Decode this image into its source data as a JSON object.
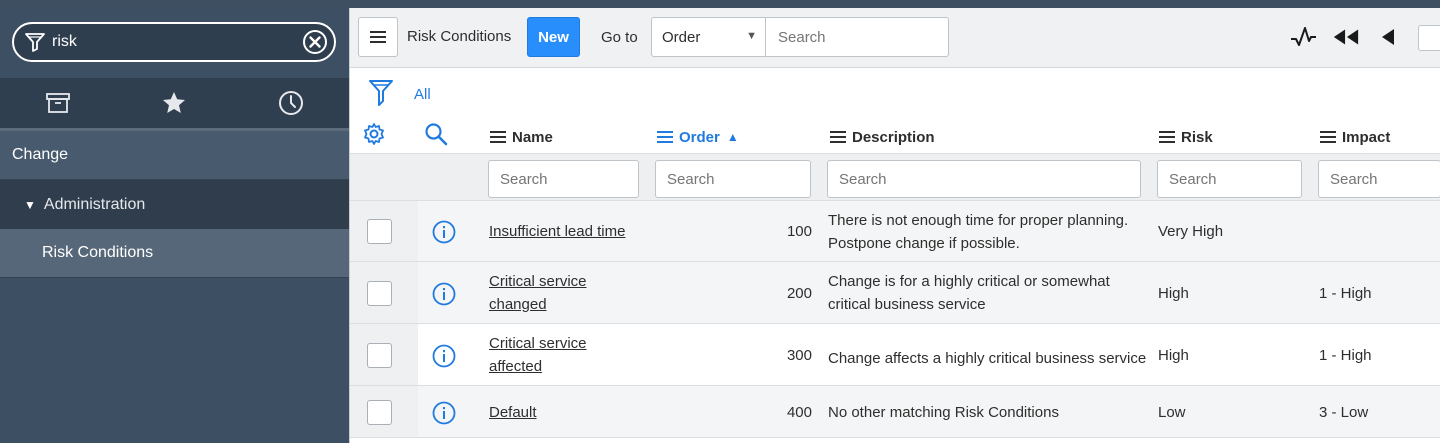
{
  "sidebar": {
    "filter_value": "risk",
    "tabs": [
      {
        "icon": "archive-icon"
      },
      {
        "icon": "star-icon"
      },
      {
        "icon": "clock-icon"
      }
    ],
    "nav": {
      "app": "Change",
      "module": "Administration",
      "item": "Risk Conditions"
    }
  },
  "header": {
    "title": "Risk Conditions",
    "new_label": "New",
    "goto_label": "Go to",
    "goto_field": "Order",
    "search_placeholder": "Search"
  },
  "breadcrumb": {
    "all_label": "All"
  },
  "table": {
    "columns": [
      {
        "label": "Name",
        "sorted": false
      },
      {
        "label": "Order",
        "sorted": true,
        "sort_dir": "asc",
        "sort_icon": "▲"
      },
      {
        "label": "Description",
        "sorted": false
      },
      {
        "label": "Risk",
        "sorted": false
      },
      {
        "label": "Impact",
        "sorted": false
      }
    ],
    "search_placeholder": "Search",
    "rows": [
      {
        "name": "Insufficient lead time",
        "order": "100",
        "description": "There is not enough time for proper planning. Postpone change if possible.",
        "risk": "Very High",
        "impact": ""
      },
      {
        "name": "Critical service changed",
        "order": "200",
        "description": "Change is for a highly critical or somewhat critical business service",
        "risk": "High",
        "impact": "1 - High"
      },
      {
        "name": "Critical service affected",
        "order": "300",
        "description": "Change affects a highly critical business service",
        "risk": "High",
        "impact": "1 - High"
      },
      {
        "name": "Default",
        "order": "400",
        "description": "No other matching Risk Conditions",
        "risk": "Low",
        "impact": "3 - Low"
      }
    ]
  },
  "colors": {
    "accent": "#278efc",
    "link_blue": "#1f7be0",
    "sidebar_bg": "#3d4f62"
  }
}
